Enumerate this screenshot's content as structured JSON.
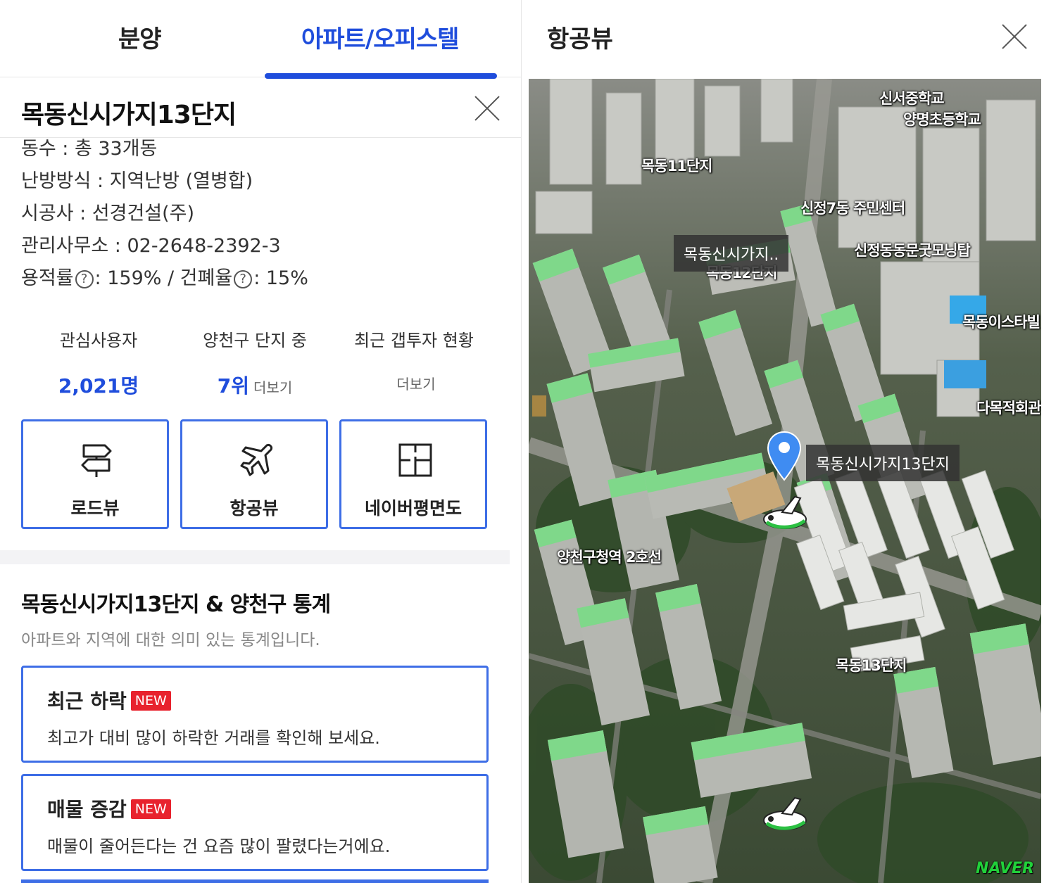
{
  "tabs": {
    "presale": "분양",
    "apartment": "아파트/오피스텔"
  },
  "complex": {
    "name": "목동신시가지13단지",
    "info": {
      "buildings": "동수 : 총 33개동",
      "heating": "난방방식 : 지역난방 (열병합)",
      "builder": "시공사 : 선경건설(주)",
      "office": "관리사무소 : 02-2648-2392-3",
      "far_label": "용적률",
      "far_value": ": 159% / ",
      "bcr_label": "건폐율",
      "bcr_value": ": 15%",
      "help_glyph": "?"
    }
  },
  "stats": {
    "interest_label": "관심사용자",
    "interest_value": "2,021명",
    "rank_label": "양천구 단지 중",
    "rank_value": "7위",
    "rank_more": "더보기",
    "gap_label": "최근 갭투자 현황",
    "gap_more": "더보기"
  },
  "view_buttons": {
    "road": "로드뷰",
    "aerial": "항공뷰",
    "floorplan": "네이버평면도"
  },
  "statistics_section": {
    "title": "목동신시가지13단지 & 양천구 통계",
    "subtitle": "아파트와 지역에 대한 의미 있는 통계입니다.",
    "cards": [
      {
        "title": "최근 하락",
        "badge": "NEW",
        "desc": "최고가 대비 많이 하락한 거래를 확인해 보세요."
      },
      {
        "title": "매물 증감",
        "badge": "NEW",
        "desc": "매물이 줄어든다는 건 요즘 많이 팔렸다는거에요."
      }
    ]
  },
  "aerial_panel": {
    "title": "항공뷰",
    "labels": {
      "school1": "신서중학교",
      "school2": "양명초등학교",
      "mokdong11": "목동11단지",
      "center": "신정7동 주민센터",
      "tower": "신정동동문굿모닝탑",
      "mokdong12": "목동12단지",
      "tooltip_small": "목동신시가지..",
      "mokdong_star": "목동이스타빌",
      "hall": "다목적회관",
      "station": "양천구청역 2호선",
      "mokdong13": "목동13단지",
      "pin_label": "목동신시가지13단지"
    },
    "watermark": "NAVER",
    "colors": {
      "pin": "#3f8cf2",
      "roof": "#7fd88a",
      "tab_active": "#1f4ddc"
    }
  }
}
